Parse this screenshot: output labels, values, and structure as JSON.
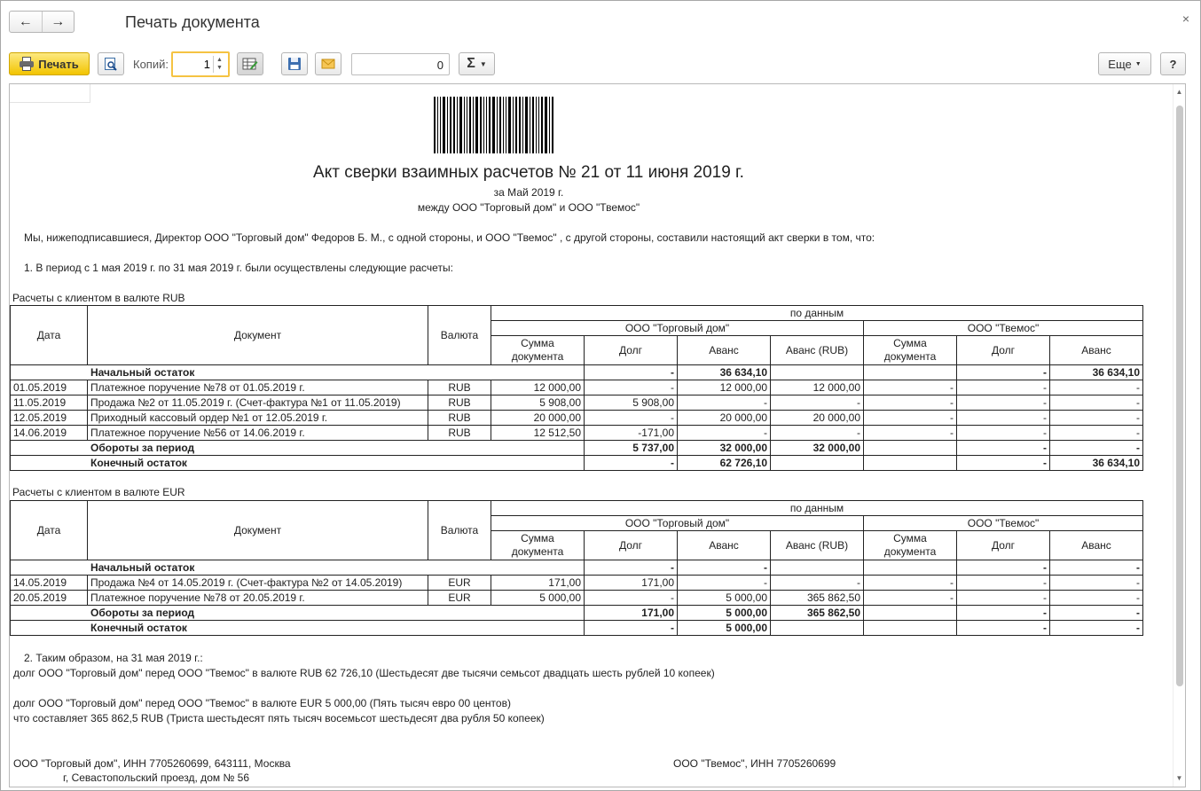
{
  "window": {
    "title": "Печать документа",
    "back_icon": "arrow-left-icon",
    "forward_icon": "arrow-right-icon",
    "close_glyph": "×"
  },
  "toolbar": {
    "print_label": "Печать",
    "copies_label": "Копий:",
    "copies_value": "1",
    "sum_value": "0",
    "sum_glyph": "Σ",
    "more_label": "Еще",
    "help_label": "?"
  },
  "document": {
    "title": "Акт сверки взаимных расчетов № 21 от 11 июня 2019 г.",
    "period": "за Май 2019 г.",
    "between": "между ООО \"Торговый дом\" и ООО \"Твемос\"",
    "intro": "Мы, нижеподписавшиеся, Директор ООО \"Торговый дом\" Федоров Б. М., с одной стороны, и  ООО \"Твемос\" , с другой стороны, составили настоящий акт сверки в том, что:",
    "point1": "1. В период с 1 мая 2019 г. по 31 мая 2019 г. были осуществлены следующие расчеты:",
    "header": {
      "date": "Дата",
      "doc": "Документ",
      "currency": "Валюта",
      "by_data": "по данным",
      "org1": "ООО \"Торговый дом\"",
      "org2": "ООО \"Твемос\"",
      "sum": "Сумма документа",
      "debt": "Долг",
      "advance": "Аванс",
      "advance_rub": "Аванс (RUB)"
    },
    "rub": {
      "caption": "Расчеты с клиентом в валюте RUB",
      "rows": [
        {
          "date": "",
          "doc": "Начальный остаток",
          "cur": "",
          "sum": "",
          "debt1": "-",
          "adv1": "36 634,10",
          "advrub": "",
          "sum2": "",
          "debt2": "-",
          "adv2": "36 634,10",
          "bold": true
        },
        {
          "date": "01.05.2019",
          "doc": "Платежное поручение №78 от 01.05.2019 г.",
          "cur": "RUB",
          "sum": "12 000,00",
          "debt1": "-",
          "adv1": "12 000,00",
          "advrub": "12 000,00",
          "sum2": "-",
          "debt2": "-",
          "adv2": "-",
          "bold": false
        },
        {
          "date": "11.05.2019",
          "doc": "Продажа №2 от 11.05.2019 г. (Счет-фактура №1 от 11.05.2019)",
          "cur": "RUB",
          "sum": "5 908,00",
          "debt1": "5 908,00",
          "adv1": "-",
          "advrub": "-",
          "sum2": "-",
          "debt2": "-",
          "adv2": "-",
          "bold": false
        },
        {
          "date": "12.05.2019",
          "doc": "Приходный кассовый ордер №1 от 12.05.2019 г.",
          "cur": "RUB",
          "sum": "20 000,00",
          "debt1": "-",
          "adv1": "20 000,00",
          "advrub": "20 000,00",
          "sum2": "-",
          "debt2": "-",
          "adv2": "-",
          "bold": false
        },
        {
          "date": "14.06.2019",
          "doc": "Платежное поручение №56 от 14.06.2019 г.",
          "cur": "RUB",
          "sum": "12 512,50",
          "debt1": "-171,00",
          "adv1": "-",
          "advrub": "-",
          "sum2": "-",
          "debt2": "-",
          "adv2": "-",
          "bold": false
        },
        {
          "date": "",
          "doc": "Обороты за период",
          "cur": "",
          "sum": "",
          "debt1": "5 737,00",
          "adv1": "32 000,00",
          "advrub": "32 000,00",
          "sum2": "",
          "debt2": "-",
          "adv2": "-",
          "bold": true
        },
        {
          "date": "",
          "doc": "Конечный остаток",
          "cur": "",
          "sum": "",
          "debt1": "-",
          "adv1": "62 726,10",
          "advrub": "",
          "sum2": "",
          "debt2": "-",
          "adv2": "36 634,10",
          "bold": true
        }
      ]
    },
    "eur": {
      "caption": "Расчеты с клиентом в валюте EUR",
      "rows": [
        {
          "date": "",
          "doc": "Начальный остаток",
          "cur": "",
          "sum": "",
          "debt1": "-",
          "adv1": "-",
          "advrub": "",
          "sum2": "",
          "debt2": "-",
          "adv2": "-",
          "bold": true
        },
        {
          "date": "14.05.2019",
          "doc": "Продажа №4 от 14.05.2019 г. (Счет-фактура №2 от 14.05.2019)",
          "cur": "EUR",
          "sum": "171,00",
          "debt1": "171,00",
          "adv1": "-",
          "advrub": "-",
          "sum2": "-",
          "debt2": "-",
          "adv2": "-",
          "bold": false
        },
        {
          "date": "20.05.2019",
          "doc": "Платежное поручение №78 от 20.05.2019 г.",
          "cur": "EUR",
          "sum": "5 000,00",
          "debt1": "-",
          "adv1": "5 000,00",
          "advrub": "365 862,50",
          "sum2": "-",
          "debt2": "-",
          "adv2": "-",
          "bold": false
        },
        {
          "date": "",
          "doc": "Обороты за период",
          "cur": "",
          "sum": "",
          "debt1": "171,00",
          "adv1": "5 000,00",
          "advrub": "365 862,50",
          "sum2": "",
          "debt2": "-",
          "adv2": "-",
          "bold": true
        },
        {
          "date": "",
          "doc": "Конечный остаток",
          "cur": "",
          "sum": "",
          "debt1": "-",
          "adv1": "5 000,00",
          "advrub": "",
          "sum2": "",
          "debt2": "-",
          "adv2": "-",
          "bold": true
        }
      ]
    },
    "point2": "2. Таким образом, на 31 мая 2019 г.:",
    "debt_rub": "долг ООО \"Торговый дом\" перед ООО \"Твемос\" в валюте RUB 62 726,10 (Шестьдесят две тысячи семьсот двадцать шесть рублей 10 копеек)",
    "debt_eur": "долг ООО \"Торговый дом\" перед ООО \"Твемос\" в валюте EUR 5 000,00 (Пять тысяч евро 00 центов)",
    "debt_eur_rub": "что составляет 365 862,5 RUB (Триста шестьдесят пять тысяч восемьсот шестьдесят два рубля 50 копеек)",
    "sign_left_1": "ООО \"Торговый дом\", ИНН 7705260699, 643111, Москва",
    "sign_left_2": "г, Севастопольский проезд, дом № 56",
    "sign_right_1": "ООО \"Твемос\", ИНН 7705260699"
  },
  "colors": {
    "print_button": "#f2c400",
    "copies_focus": "#f5c342"
  }
}
